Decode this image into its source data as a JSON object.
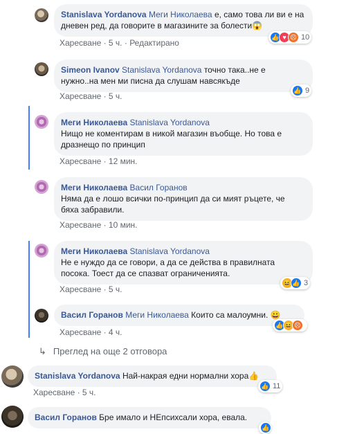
{
  "comments": [
    {
      "author": "Stanislava Yordanova",
      "mention": "Меги Николаева",
      "text": " е, само това ли ви е на дневен ред, да говорите в магазините за болести😱",
      "actions": {
        "like": "Харесване",
        "time": "5 ч.",
        "extra": "Редактирано"
      },
      "reactions": {
        "count": "10",
        "types": [
          "like",
          "love",
          "angry"
        ]
      }
    },
    {
      "author": "Simeon Ivanov",
      "mention": "Stanislava Yordanova",
      "text": " точно така..не е нужно..на мен ми писна да слушам навсякъде",
      "actions": {
        "like": "Харесване",
        "time": "5 ч."
      },
      "reactions": {
        "count": "9",
        "types": [
          "like"
        ]
      }
    },
    {
      "author": "Меги Николаева",
      "mention": "Stanislava Yordanova",
      "text": "Нищо не коментирам в никой магазин въобще. Но това е дразнещо по принцип",
      "actions": {
        "like": "Харесване",
        "time": "12 мин."
      }
    },
    {
      "author": "Меги Николаева",
      "mention": "Васил Горанов",
      "text": "Няма да е лошо всички по-принцип да си мият ръцете, че бяха забравили.",
      "actions": {
        "like": "Харесване",
        "time": "10 мин."
      }
    },
    {
      "author": "Меги Николаева",
      "mention": "Stanislava Yordanova",
      "text": "Не е нуждо да се говори, а да се действа в правилната посока. Тоест да се спазват ограниченията.",
      "actions": {
        "like": "Харесване",
        "time": "5 ч."
      },
      "reactions": {
        "count": "3",
        "types": [
          "haha",
          "like"
        ]
      }
    },
    {
      "author": "Васил Горанов",
      "mention": "Меги Николаева",
      "text": " Които са малоумни. 😀",
      "actions": {
        "like": "Харесване",
        "time": "4 ч."
      },
      "reactions": {
        "count": "",
        "types": [
          "like",
          "haha",
          "angry"
        ]
      }
    }
  ],
  "more_replies": "Преглед на още 2 отговора",
  "top_level": [
    {
      "author": "Stanislava Yordanova",
      "text": " Най-накрая едни нормални хора👍",
      "actions": {
        "like": "Харесване",
        "time": "5 ч."
      },
      "reactions": {
        "count": "11",
        "types": [
          "like"
        ]
      }
    },
    {
      "author": "Васил Горанов",
      "text": " Бре имало и НЕпсихсали хора, евала.",
      "reactions": {
        "count": "",
        "types": [
          "like"
        ]
      }
    }
  ],
  "separator": " · "
}
